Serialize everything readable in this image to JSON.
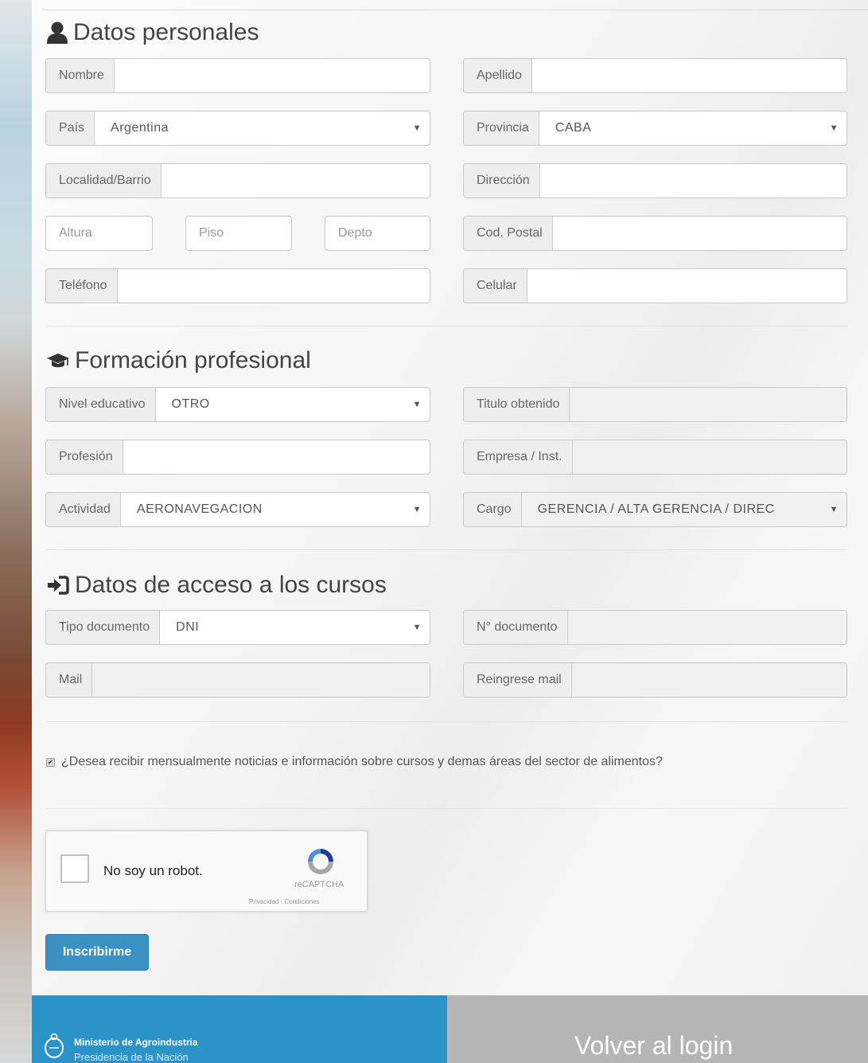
{
  "sections": {
    "personal": {
      "title": "Datos personales",
      "nombre_label": "Nombre",
      "apellido_label": "Apellido",
      "pais_label": "País",
      "pais_value": "Argentina",
      "provincia_label": "Provincia",
      "provincia_value": "CABA",
      "localidad_label": "Localidad/Barrio",
      "direccion_label": "Dirección",
      "altura_placeholder": "Altura",
      "piso_placeholder": "Piso",
      "depto_placeholder": "Depto",
      "codpostal_label": "Cod. Postal",
      "telefono_label": "Teléfono",
      "celular_label": "Celular"
    },
    "training": {
      "title": "Formación profesional",
      "nivel_label": "Nivel educativo",
      "nivel_value": "OTRO",
      "titulo_label": "Titulo obtenido",
      "profesion_label": "Profesión",
      "empresa_label": "Empresa / Inst.",
      "actividad_label": "Actividad",
      "actividad_value": "AERONAVEGACION",
      "cargo_label": "Cargo",
      "cargo_value": "GERENCIA / ALTA GERENCIA / DIREC"
    },
    "access": {
      "title": "Datos de acceso a los cursos",
      "tipo_doc_label": "Tipo documento",
      "tipo_doc_value": "DNI",
      "nro_doc_label": "N° documento",
      "mail_label": "Mail",
      "reingrese_label": "Reingrese mail"
    }
  },
  "newsletter": {
    "checked": true,
    "label": "¿Desea recibir mensualmente noticias e información sobre cursos y demas áreas del sector de alimentos?"
  },
  "captcha": {
    "label": "No soy un robot.",
    "brand": "reCAPTCHA",
    "terms": "Privacidad - Condiciones"
  },
  "submit_label": "Inscribirme",
  "footer": {
    "ministry_line1": "Ministerio de Agroindustria",
    "ministry_line2": "Presidencia de la Nación",
    "back_login": "Volver al login"
  },
  "colors": {
    "primary_button": "#3b91c3",
    "footer_blue": "#2c93c8",
    "footer_gray": "#b5b5b5"
  }
}
